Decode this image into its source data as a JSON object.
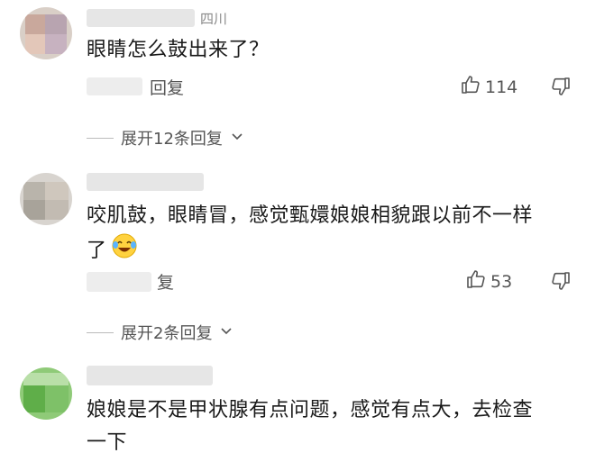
{
  "comments": [
    {
      "name_tail": "四川",
      "text": "眼睛怎么鼓出来了？",
      "reply_label": "回复",
      "likes": "114",
      "expand_label": "展开12条回复"
    },
    {
      "text_line1": "咬肌鼓，眼睛冒，感觉甄嬛娘娘相貌跟以前不一样",
      "text_line2": "了",
      "reply_label": "复",
      "likes": "53",
      "expand_label": "展开2条回复"
    },
    {
      "text_line1": "娘娘是不是甲状腺有点问题，感觉有点大，去检查",
      "text_line2": "一下"
    }
  ]
}
